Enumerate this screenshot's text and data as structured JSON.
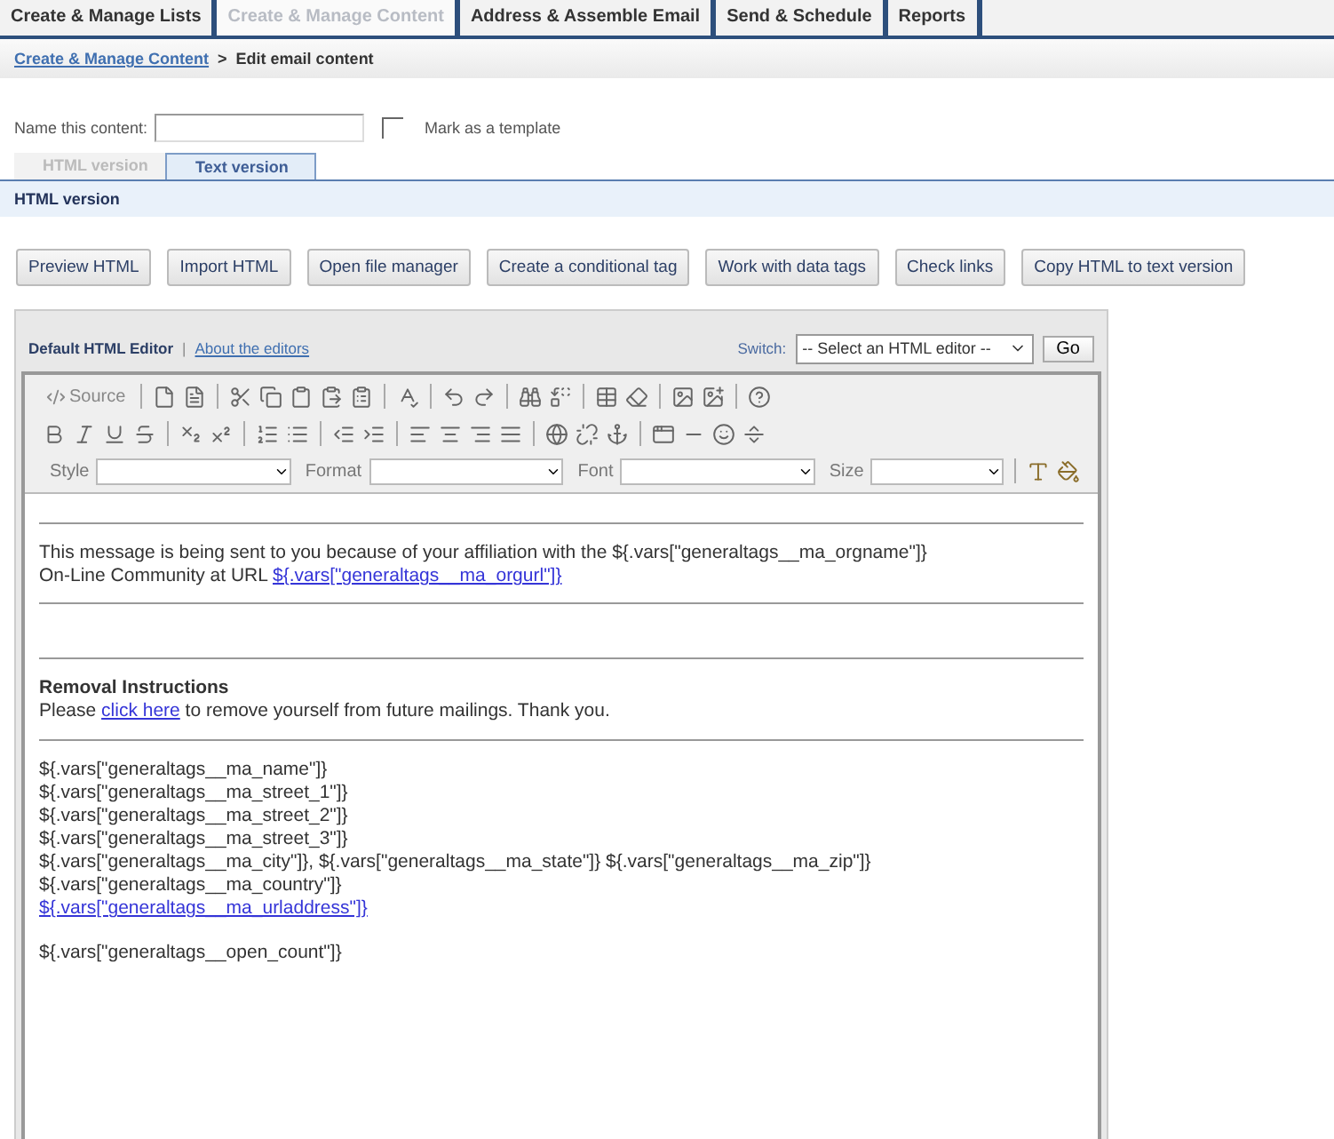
{
  "top_tabs": [
    {
      "label": "Create & Manage Lists",
      "selected": false
    },
    {
      "label": "Create & Manage Content",
      "selected": true
    },
    {
      "label": "Address & Assemble Email",
      "selected": false
    },
    {
      "label": "Send & Schedule",
      "selected": false
    },
    {
      "label": "Reports",
      "selected": false
    }
  ],
  "breadcrumb": {
    "link": "Create & Manage Content",
    "separator": ">",
    "current": "Edit email content"
  },
  "name_field": {
    "label": "Name this content:"
  },
  "template_checkbox": {
    "label": "Mark as a template",
    "checked": false
  },
  "version_tabs": [
    {
      "label": "HTML version",
      "selected": true
    },
    {
      "label": "Text version",
      "selected": false
    }
  ],
  "section_title": "HTML version",
  "buttons": [
    "Preview HTML",
    "Import HTML",
    "Open file manager",
    "Create a conditional tag",
    "Work with data tags",
    "Check links",
    "Copy HTML to text version"
  ],
  "editor": {
    "title": "Default HTML Editor",
    "separator": "|",
    "about_link": "About the editors",
    "switch_label": "Switch:",
    "switch_select": {
      "value": "-- Select an HTML editor --"
    },
    "go_button": "Go",
    "source_button": "Source",
    "combos": [
      {
        "label": "Style"
      },
      {
        "label": "Format"
      },
      {
        "label": "Font"
      },
      {
        "label": "Size"
      }
    ],
    "content": [
      {
        "kind": "rule"
      },
      {
        "kind": "paragraph",
        "lines": [
          [
            {
              "text": "This message is being sent to you because of your affiliation with the ${.vars[\"generaltags__ma_orgname\"]}",
              "link": false
            }
          ],
          [
            {
              "text": "On-Line Community at URL ",
              "link": false
            },
            {
              "text": "${.vars[\"generaltags__ma_orgurl\"]}",
              "link": true
            }
          ]
        ]
      },
      {
        "kind": "rule"
      },
      {
        "kind": "blank"
      },
      {
        "kind": "rule"
      },
      {
        "kind": "heading",
        "text": "Removal Instructions"
      },
      {
        "kind": "paragraph",
        "lines": [
          [
            {
              "text": "Please ",
              "link": false
            },
            {
              "text": "click here",
              "link": true
            },
            {
              "text": " to remove yourself from future mailings. Thank you.",
              "link": false
            }
          ]
        ]
      },
      {
        "kind": "rule"
      },
      {
        "kind": "paragraph",
        "lines": [
          [
            {
              "text": "${.vars[\"generaltags__ma_name\"]}",
              "link": false
            }
          ]
        ]
      },
      {
        "kind": "paragraph",
        "lines": [
          [
            {
              "text": "${.vars[\"generaltags__ma_street_1\"]}",
              "link": false
            }
          ]
        ]
      },
      {
        "kind": "paragraph",
        "lines": [
          [
            {
              "text": "${.vars[\"generaltags__ma_street_2\"]}",
              "link": false
            }
          ]
        ]
      },
      {
        "kind": "paragraph",
        "lines": [
          [
            {
              "text": "${.vars[\"generaltags__ma_street_3\"]}",
              "link": false
            }
          ]
        ]
      },
      {
        "kind": "paragraph",
        "lines": [
          [
            {
              "text": "${.vars[\"generaltags__ma_city\"]}, ${.vars[\"generaltags__ma_state\"]} ${.vars[\"generaltags__ma_zip\"]}",
              "link": false
            }
          ]
        ]
      },
      {
        "kind": "paragraph",
        "lines": [
          [
            {
              "text": "${.vars[\"generaltags__ma_country\"]}",
              "link": false
            }
          ]
        ]
      },
      {
        "kind": "paragraph",
        "lines": [
          [
            {
              "text": "${.vars[\"generaltags__ma_urladdress\"]}",
              "link": true
            }
          ]
        ]
      },
      {
        "kind": "blank"
      },
      {
        "kind": "paragraph",
        "lines": [
          [
            {
              "text": "${.vars[\"generaltags__open_count\"]}",
              "link": false
            }
          ]
        ]
      }
    ]
  }
}
